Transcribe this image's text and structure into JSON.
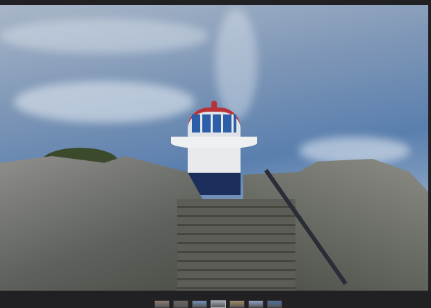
{
  "viewer": {
    "image_subject": "lighthouse",
    "background_color": "#212023"
  },
  "thumbnails": [
    {
      "color": "#8a7a70",
      "selected": false
    },
    {
      "color": "#6a6560",
      "selected": false
    },
    {
      "color": "#6f8fb5",
      "selected": false
    },
    {
      "color": "#9aa4b3",
      "selected": true
    },
    {
      "color": "#a28a63",
      "selected": false
    },
    {
      "color": "#8d9fc6",
      "selected": false
    },
    {
      "color": "#4f6e9c",
      "selected": false
    }
  ]
}
